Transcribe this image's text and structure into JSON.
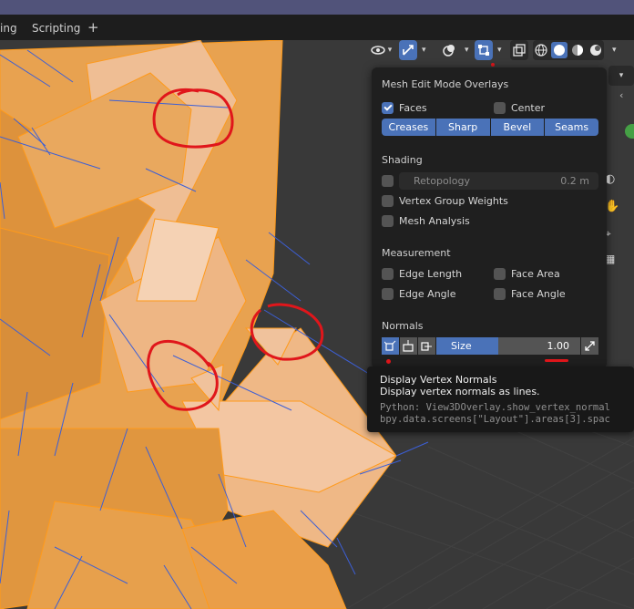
{
  "workspace_tabs": [
    {
      "label": "ing"
    },
    {
      "label": "Scripting"
    }
  ],
  "add_tab_label": "+",
  "header": {
    "icons": [
      "visibility-icon",
      "gizmo-icon",
      "overlay-icon",
      "mesh-overlay-icon",
      "xray-icon",
      "wireframe-shading-icon",
      "solid-shading-icon",
      "material-shading-icon",
      "rendered-shading-icon"
    ]
  },
  "panel": {
    "title": "Mesh Edit Mode Overlays",
    "faces_label": "Faces",
    "faces_checked": true,
    "center_label": "Center",
    "center_checked": false,
    "segments": [
      "Creases",
      "Sharp",
      "Bevel",
      "Seams"
    ],
    "shading_title": "Shading",
    "retopology_label": "Retopology",
    "retopology_value": "0.2 m",
    "vertex_group_weights_label": "Vertex Group Weights",
    "mesh_analysis_label": "Mesh Analysis",
    "measurement_title": "Measurement",
    "edge_length_label": "Edge Length",
    "face_area_label": "Face Area",
    "edge_angle_label": "Edge Angle",
    "face_angle_label": "Face Angle",
    "normals_title": "Normals",
    "size_label": "Size",
    "size_value": "1.00"
  },
  "tooltip": {
    "title": "Display Vertex Normals",
    "description": "Display vertex normals as lines.",
    "python": "Python: View3DOverlay.show_vertex_normal",
    "bpy": "bpy.data.screens[\"Layout\"].areas[3].spac"
  },
  "colors": {
    "accent": "#4a72b8",
    "mesh_face": "#e9a052",
    "mesh_edge": "#ff9a1a",
    "normal_line": "#3c5fd6",
    "annotation": "#e0161b"
  }
}
